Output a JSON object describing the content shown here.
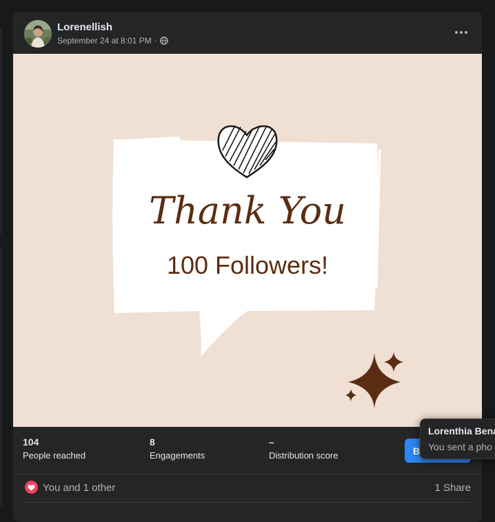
{
  "post": {
    "author": "Lorenellish",
    "timestamp": "September 24 at 8:01 PM",
    "separator": "·",
    "privacy_icon": "globe-icon",
    "more_icon": "more-horizontal-icon"
  },
  "image": {
    "headline": "Thank You",
    "subline": "100 Followers!",
    "background": "#f0dfd3",
    "ink_color": "#5a2d12"
  },
  "insights": {
    "reach": {
      "value": "104",
      "label": "People reached"
    },
    "engagements": {
      "value": "8",
      "label": "Engagements"
    },
    "distribution": {
      "value": "–",
      "label": "Distribution score"
    },
    "boost_label": "Boost post"
  },
  "reactions": {
    "icon": "love-reaction-icon",
    "text": "You and 1 other",
    "shares": "1 Share"
  },
  "tooltip": {
    "name": "Lorenthia Bena",
    "message": "You sent a pho"
  },
  "colors": {
    "accent": "#2d86f3",
    "love": "#f3425f",
    "card": "#242526",
    "page": "#18191a"
  }
}
